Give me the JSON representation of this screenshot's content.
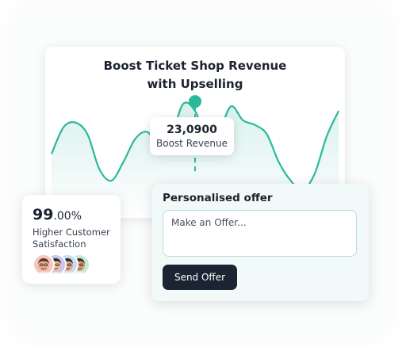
{
  "chart_card": {
    "title_line1": "Boost Ticket Shop Revenue",
    "title_line2": "with Upselling",
    "accent_color": "#2bb89a",
    "fill_color": "#d8f1ec"
  },
  "chart_data": {
    "type": "area",
    "title": "Boost Ticket Shop Revenue with Upselling",
    "x": [
      0,
      1,
      2,
      3,
      4,
      5,
      6,
      7,
      8,
      9,
      10,
      11,
      12,
      13,
      14,
      15,
      16,
      17,
      18,
      19,
      20,
      21,
      22,
      23,
      24
    ],
    "series": [
      {
        "values": [
          55,
          78,
          82,
          72,
          42,
          32,
          48,
          68,
          74,
          62,
          70,
          98,
          92,
          68,
          74,
          96,
          84,
          80,
          72,
          48,
          32,
          24,
          38,
          70,
          92
        ]
      }
    ],
    "ylim": [
      0,
      120
    ],
    "highlight_index": 12,
    "grid": false
  },
  "tooltip": {
    "value": "23,0900",
    "label": "Boost Revenue"
  },
  "stats_card": {
    "value_main": "99",
    "value_decimal": ".00%",
    "label": "Higher Customer Satisfaction",
    "avatars": [
      {
        "name": "avatar-1-icon",
        "bg": "#f6c6c4",
        "skin": "#e8b08c",
        "hair": "#5a3a22"
      },
      {
        "name": "avatar-2-icon",
        "bg": "#c9c6f2",
        "skin": "#f0c29a",
        "hair": "#3b2a1e"
      },
      {
        "name": "avatar-3-icon",
        "bg": "#c7dcf4",
        "skin": "#e2a986",
        "hair": "#2c2c2c"
      },
      {
        "name": "avatar-4-icon",
        "bg": "#c6ecd6",
        "skin": "#d9a07a",
        "hair": "#4a3020"
      }
    ]
  },
  "offer_card": {
    "title": "Personalised offer",
    "input_value": "",
    "input_placeholder": "Make an Offer...",
    "button_label": "Send Offer",
    "button_color": "#1b2433"
  }
}
